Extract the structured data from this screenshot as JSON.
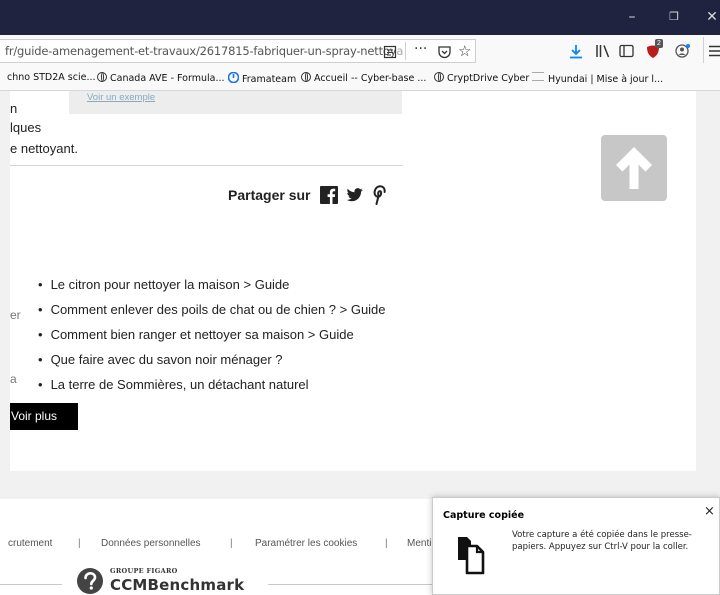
{
  "browser": {
    "window_buttons": [
      "–",
      "❐",
      "✕"
    ],
    "url_main": "fr/guide-amenagement-et-travaux/2617815-fabriquer-un-spray-nettoy",
    "url_fade": "a",
    "ublock_badge": "2",
    "bookmarks": [
      "chno STD2A scie...",
      "Canada AVE - Formula...",
      "Framateam",
      "Accueil -- Cyber-base ...",
      "CryptDrive Cyber",
      "Hyundai | Mise à jour l..."
    ]
  },
  "article": {
    "example_link": "Voir un exemple",
    "frag_1": "n",
    "frag_2": "lques",
    "frag_3": "e nettoyant.",
    "share_label": "Partager sur",
    "side_frag_1": "er",
    "side_frag_2": "a"
  },
  "related": {
    "items": [
      "Le citron pour nettoyer la maison > Guide",
      "Comment enlever des poils de chat ou de chien ? > Guide",
      "Comment bien ranger et nettoyer sa maison > Guide",
      "Que faire avec du savon noir ménager ?",
      "La terre de Sommières, un détachant naturel"
    ],
    "more_button": "Voir plus"
  },
  "footer": {
    "links": [
      "crutement",
      "Données personnelles",
      "Paramétrer les cookies",
      "Menti"
    ],
    "brand_top": "GROUPE FIGARO",
    "brand_name": "CCMBenchmark"
  },
  "toast": {
    "title": "Capture copiée",
    "message": "Votre capture a été copiée dans le presse-papiers. Appuyez sur Ctrl-V pour la coller.",
    "close": "×"
  },
  "colors": {
    "titlebar": "#202340",
    "download_blue": "#0a84ff",
    "ublock_red": "#b81e1e"
  }
}
